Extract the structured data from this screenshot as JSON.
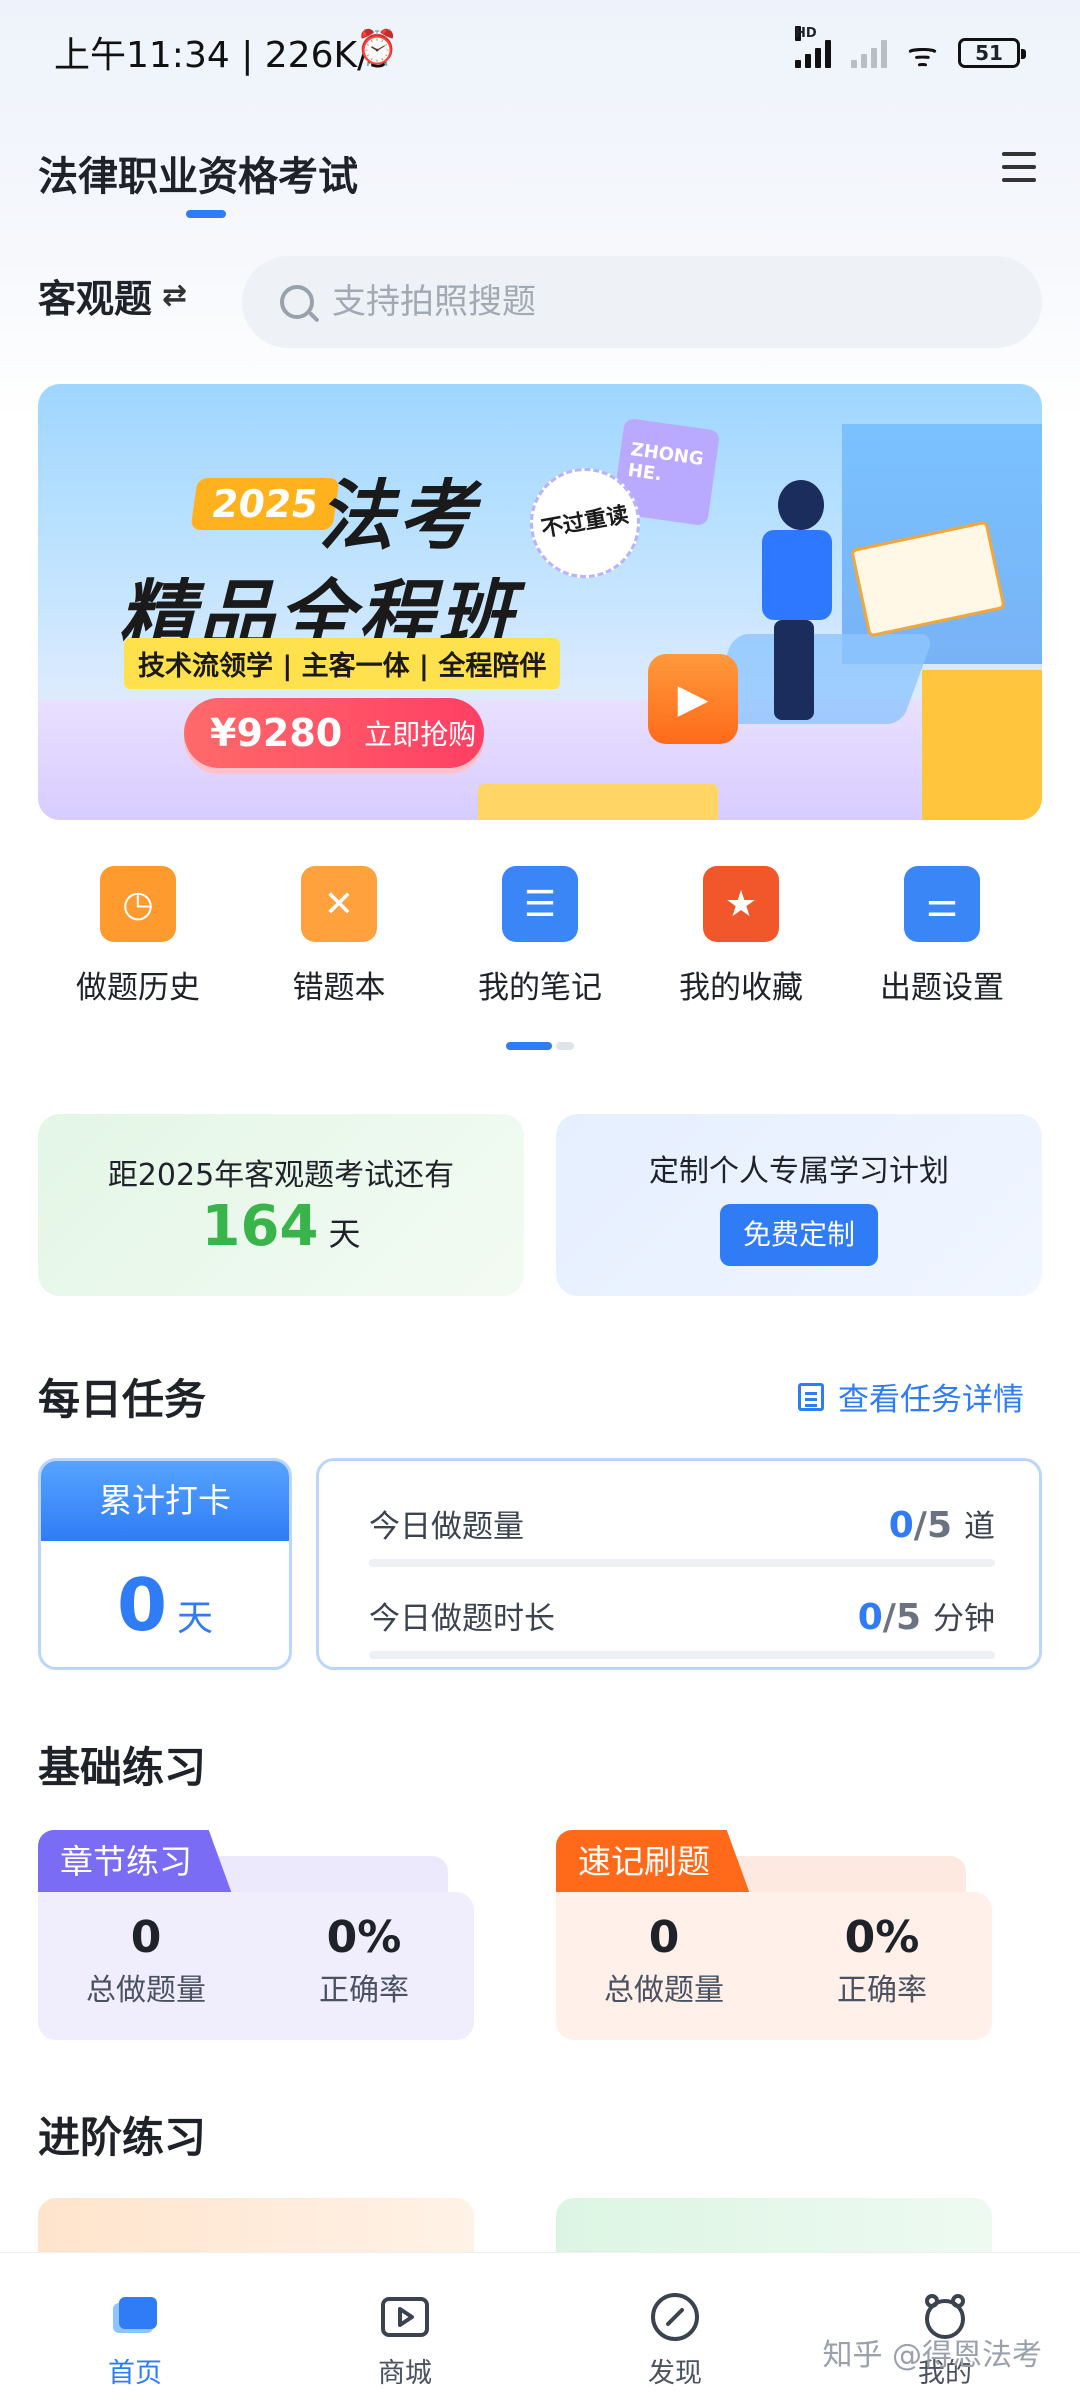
{
  "status_bar": {
    "time": "上午11:34 | 226K/s",
    "alarm_icon": "alarm-clock-icon",
    "battery": "51"
  },
  "header": {
    "title": "法律职业资格考试",
    "menu_icon": "menu-icon"
  },
  "subject": {
    "label": "客观题",
    "swap_icon": "⇄"
  },
  "search": {
    "placeholder": "支持拍照搜题"
  },
  "banner": {
    "year": "2025",
    "headline": "法考",
    "subheadline": "精品全程班",
    "tags": "技术流领学 | 主客一体 | 全程陪伴",
    "price": "¥9280",
    "cta": "立即抢购",
    "stamp": "不过重读",
    "card_text": "ZHONG HE."
  },
  "quick_actions": [
    {
      "label": "做题历史",
      "icon": "history-icon",
      "color": "#ff9a2e"
    },
    {
      "label": "错题本",
      "icon": "wrong-book-icon",
      "color": "#ffa23e"
    },
    {
      "label": "我的笔记",
      "icon": "notes-icon",
      "color": "#3a86f7"
    },
    {
      "label": "我的收藏",
      "icon": "favorite-star-icon",
      "color": "#f2562b"
    },
    {
      "label": "出题设置",
      "icon": "settings-sliders-icon",
      "color": "#3a86f7"
    }
  ],
  "countdown": {
    "label": "距2025年客观题考试还有",
    "days": "164",
    "unit": "天"
  },
  "plan": {
    "label": "定制个人专属学习计划",
    "button": "免费定制"
  },
  "daily_task": {
    "title": "每日任务",
    "detail_link": "查看任务详情",
    "checkin": {
      "label": "累计打卡",
      "value": "0",
      "unit": "天"
    },
    "rows": [
      {
        "label": "今日做题量",
        "current": "0",
        "total": "/5",
        "unit": "道",
        "progress": 0
      },
      {
        "label": "今日做题时长",
        "current": "0",
        "total": "/5",
        "unit": "分钟",
        "progress": 0
      }
    ]
  },
  "basic_practice": {
    "title": "基础练习",
    "cards": [
      {
        "name": "章节练习",
        "count": "0",
        "count_label": "总做题量",
        "accuracy": "0%",
        "accuracy_label": "正确率",
        "color": "#7b6cf6"
      },
      {
        "name": "速记刷题",
        "count": "0",
        "count_label": "总做题量",
        "accuracy": "0%",
        "accuracy_label": "正确率",
        "color": "#ff6a1a"
      }
    ]
  },
  "advanced_practice": {
    "title": "进阶练习"
  },
  "bottom_nav": [
    {
      "label": "首页",
      "icon": "home-icon",
      "active": true
    },
    {
      "label": "商城",
      "icon": "mall-icon",
      "active": false
    },
    {
      "label": "发现",
      "icon": "discover-compass-icon",
      "active": false
    },
    {
      "label": "我的",
      "icon": "profile-icon",
      "active": false
    }
  ],
  "watermark": "知乎 @得恩法考",
  "colors": {
    "accent": "#2f7cf6",
    "success": "#38b44a"
  }
}
